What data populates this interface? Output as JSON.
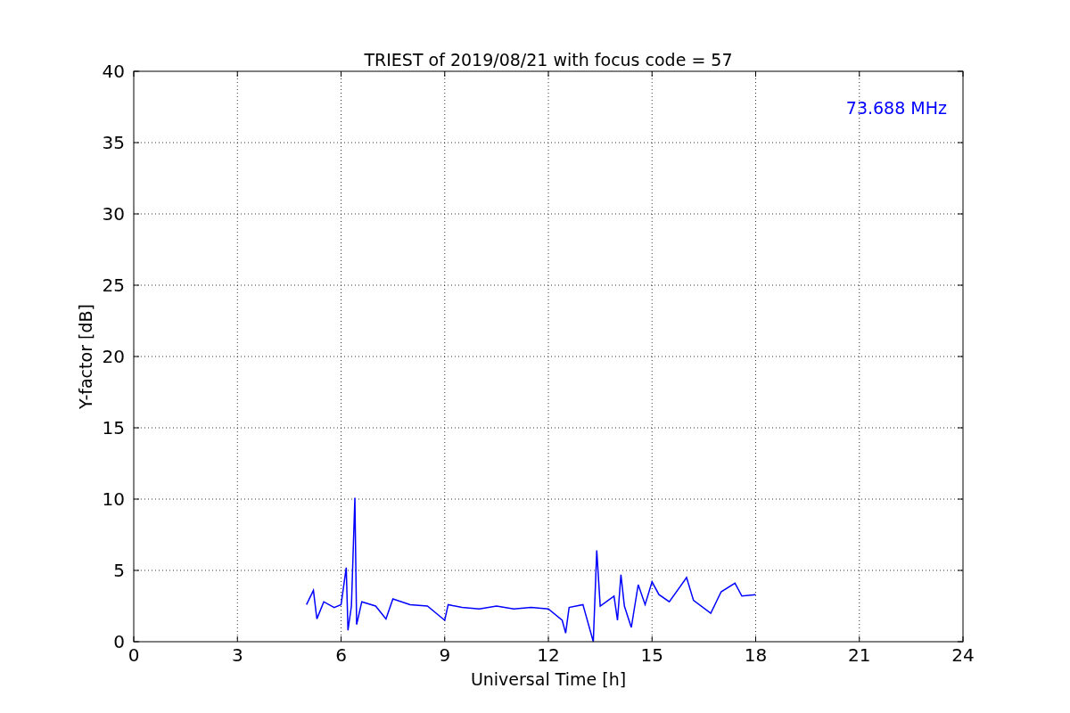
{
  "chart_data": {
    "type": "line",
    "title": "TRIEST of 2019/08/21 with focus code = 57",
    "xlabel": "Universal Time [h]",
    "ylabel": "Y-factor [dB]",
    "xlim": [
      0,
      24
    ],
    "ylim": [
      0,
      40
    ],
    "xticks": [
      0,
      3,
      6,
      9,
      12,
      15,
      18,
      21,
      24
    ],
    "yticks": [
      0,
      5,
      10,
      15,
      20,
      25,
      30,
      35,
      40
    ],
    "series": [
      {
        "name": "73.688 MHz",
        "color": "#0000ff",
        "x": [
          5.0,
          5.2,
          5.3,
          5.5,
          5.8,
          6.0,
          6.15,
          6.2,
          6.3,
          6.4,
          6.45,
          6.6,
          7.0,
          7.3,
          7.5,
          8.0,
          8.5,
          9.0,
          9.1,
          9.5,
          10.0,
          10.5,
          11.0,
          11.5,
          12.0,
          12.4,
          12.5,
          12.6,
          13.0,
          13.3,
          13.4,
          13.5,
          13.9,
          14.0,
          14.1,
          14.2,
          14.4,
          14.6,
          14.8,
          15.0,
          15.2,
          15.5,
          16.0,
          16.2,
          16.7,
          17.0,
          17.4,
          17.6,
          18.0
        ],
        "values": [
          2.6,
          3.6,
          1.6,
          2.8,
          2.4,
          2.6,
          5.2,
          0.8,
          2.5,
          10.1,
          1.2,
          2.8,
          2.5,
          1.6,
          3.0,
          2.6,
          2.5,
          1.5,
          2.6,
          2.4,
          2.3,
          2.5,
          2.3,
          2.4,
          2.3,
          1.5,
          0.6,
          2.4,
          2.6,
          0.0,
          6.4,
          2.5,
          3.2,
          1.5,
          4.7,
          2.5,
          1.0,
          4.0,
          2.6,
          4.2,
          3.3,
          2.8,
          4.5,
          2.9,
          2.0,
          3.5,
          4.1,
          3.2,
          3.3
        ]
      }
    ],
    "grid": true
  }
}
